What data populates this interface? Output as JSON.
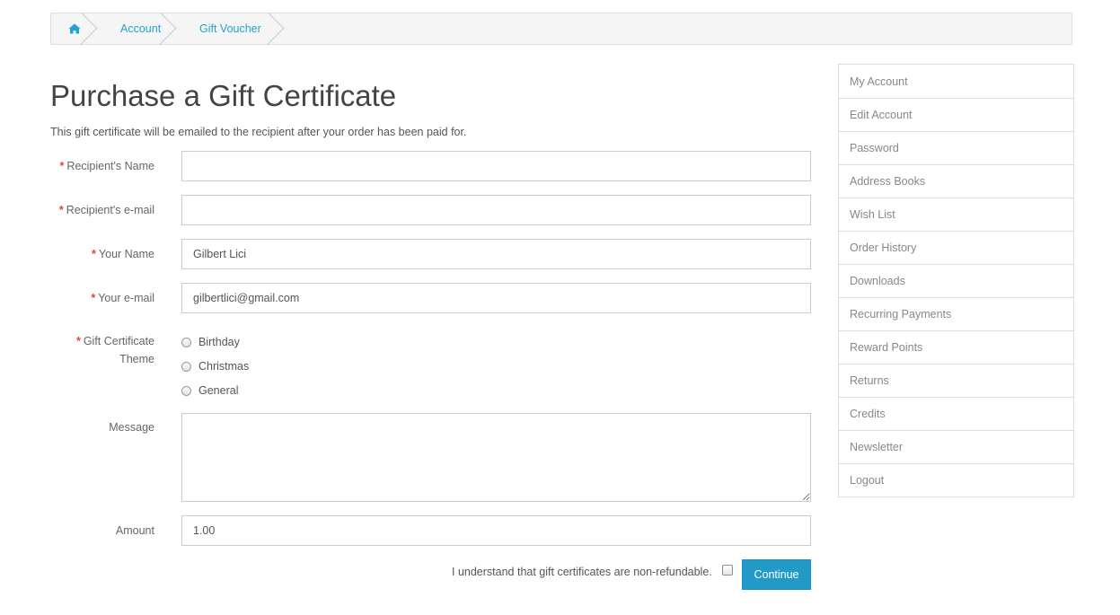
{
  "breadcrumb": {
    "home_icon": "home-icon",
    "items": [
      "Account",
      "Gift Voucher"
    ]
  },
  "page": {
    "title": "Purchase a Gift Certificate",
    "intro": "This gift certificate will be emailed to the recipient after your order has been paid for."
  },
  "form": {
    "required_mark": "*",
    "recipient_name": {
      "label": "Recipient's Name",
      "value": ""
    },
    "recipient_email": {
      "label": "Recipient's e-mail",
      "value": ""
    },
    "your_name": {
      "label": "Your Name",
      "value": "Gilbert Lici"
    },
    "your_email": {
      "label": "Your e-mail",
      "value": "gilbertlici@gmail.com"
    },
    "theme": {
      "label_line1": "Gift Certificate",
      "label_line2": "Theme",
      "options": [
        "Birthday",
        "Christmas",
        "General"
      ]
    },
    "message": {
      "label": "Message",
      "value": ""
    },
    "amount": {
      "label": "Amount",
      "value": "1.00"
    },
    "agree_text": "I understand that gift certificates are non-refundable.",
    "continue_label": "Continue"
  },
  "sidebar": {
    "items": [
      "My Account",
      "Edit Account",
      "Password",
      "Address Books",
      "Wish List",
      "Order History",
      "Downloads",
      "Recurring Payments",
      "Reward Points",
      "Returns",
      "Credits",
      "Newsletter",
      "Logout"
    ]
  },
  "colors": {
    "link": "#23a1d1",
    "button": "#229ac8",
    "required": "#e33f3f"
  }
}
